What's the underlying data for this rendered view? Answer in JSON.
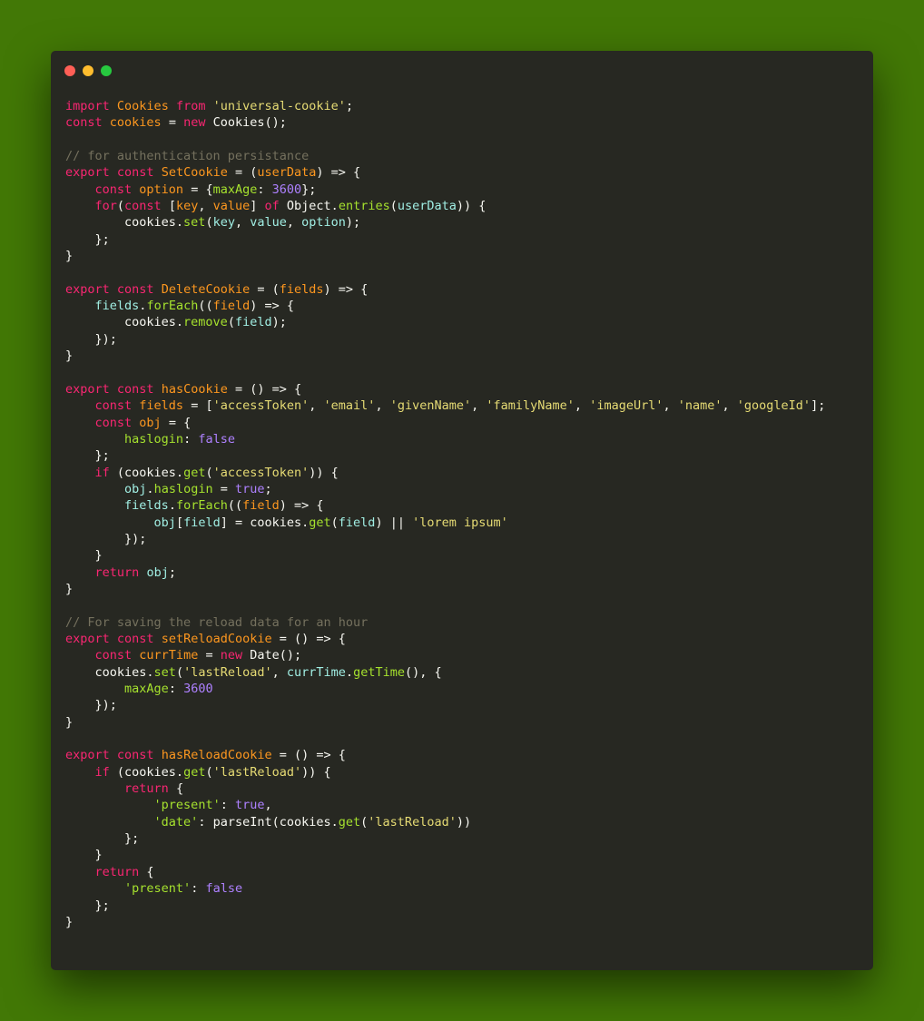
{
  "window": {
    "controls": [
      {
        "name": "close",
        "color": "#ff5f56"
      },
      {
        "name": "minimize",
        "color": "#ffbd2e"
      },
      {
        "name": "maximize",
        "color": "#27c93f"
      }
    ]
  },
  "theme": {
    "background": "#427806",
    "editor_bg": "#272822",
    "keyword": "#f92672",
    "definition": "#fd971f",
    "string": "#e6db74",
    "comment": "#75715e",
    "function": "#a6e22e",
    "variable": "#a1efe4",
    "number": "#ae81ff",
    "text": "#f8f8f2"
  },
  "code": {
    "language": "javascript",
    "lines": [
      [
        [
          "kw",
          "import"
        ],
        [
          "t",
          " "
        ],
        [
          "def",
          "Cookies"
        ],
        [
          "t",
          " "
        ],
        [
          "kw",
          "from"
        ],
        [
          "t",
          " "
        ],
        [
          "str",
          "'universal-cookie'"
        ],
        [
          "t",
          ";"
        ]
      ],
      [
        [
          "kw",
          "const"
        ],
        [
          "t",
          " "
        ],
        [
          "def",
          "cookies"
        ],
        [
          "t",
          " = "
        ],
        [
          "kw",
          "new"
        ],
        [
          "t",
          " Cookies();"
        ]
      ],
      [],
      [
        [
          "com",
          "// for authentication persistance"
        ]
      ],
      [
        [
          "kw",
          "export"
        ],
        [
          "t",
          " "
        ],
        [
          "kw",
          "const"
        ],
        [
          "t",
          " "
        ],
        [
          "def",
          "SetCookie"
        ],
        [
          "t",
          " = ("
        ],
        [
          "def",
          "userData"
        ],
        [
          "t",
          ") => {"
        ]
      ],
      [
        [
          "t",
          "    "
        ],
        [
          "kw",
          "const"
        ],
        [
          "t",
          " "
        ],
        [
          "def",
          "option"
        ],
        [
          "t",
          " = {"
        ],
        [
          "fn",
          "maxAge"
        ],
        [
          "t",
          ": "
        ],
        [
          "num",
          "3600"
        ],
        [
          "t",
          "};"
        ]
      ],
      [
        [
          "t",
          "    "
        ],
        [
          "kw",
          "for"
        ],
        [
          "t",
          "("
        ],
        [
          "kw",
          "const"
        ],
        [
          "t",
          " ["
        ],
        [
          "def",
          "key"
        ],
        [
          "t",
          ", "
        ],
        [
          "def",
          "value"
        ],
        [
          "t",
          "] "
        ],
        [
          "kw",
          "of"
        ],
        [
          "t",
          " Object."
        ],
        [
          "fn",
          "entries"
        ],
        [
          "t",
          "("
        ],
        [
          "var",
          "userData"
        ],
        [
          "t",
          ")) {"
        ]
      ],
      [
        [
          "t",
          "        cookies."
        ],
        [
          "fn",
          "set"
        ],
        [
          "t",
          "("
        ],
        [
          "var",
          "key"
        ],
        [
          "t",
          ", "
        ],
        [
          "var",
          "value"
        ],
        [
          "t",
          ", "
        ],
        [
          "var",
          "option"
        ],
        [
          "t",
          ");"
        ]
      ],
      [
        [
          "t",
          "    };"
        ]
      ],
      [
        [
          "t",
          "}"
        ]
      ],
      [],
      [
        [
          "kw",
          "export"
        ],
        [
          "t",
          " "
        ],
        [
          "kw",
          "const"
        ],
        [
          "t",
          " "
        ],
        [
          "def",
          "DeleteCookie"
        ],
        [
          "t",
          " = ("
        ],
        [
          "def",
          "fields"
        ],
        [
          "t",
          ") => {"
        ]
      ],
      [
        [
          "t",
          "    "
        ],
        [
          "var",
          "fields"
        ],
        [
          "t",
          "."
        ],
        [
          "fn",
          "forEach"
        ],
        [
          "t",
          "(("
        ],
        [
          "def",
          "field"
        ],
        [
          "t",
          ") => {"
        ]
      ],
      [
        [
          "t",
          "        cookies."
        ],
        [
          "fn",
          "remove"
        ],
        [
          "t",
          "("
        ],
        [
          "var",
          "field"
        ],
        [
          "t",
          ");"
        ]
      ],
      [
        [
          "t",
          "    });"
        ]
      ],
      [
        [
          "t",
          "}"
        ]
      ],
      [],
      [
        [
          "kw",
          "export"
        ],
        [
          "t",
          " "
        ],
        [
          "kw",
          "const"
        ],
        [
          "t",
          " "
        ],
        [
          "def",
          "hasCookie"
        ],
        [
          "t",
          " = () => {"
        ]
      ],
      [
        [
          "t",
          "    "
        ],
        [
          "kw",
          "const"
        ],
        [
          "t",
          " "
        ],
        [
          "def",
          "fields"
        ],
        [
          "t",
          " = ["
        ],
        [
          "str",
          "'accessToken'"
        ],
        [
          "t",
          ", "
        ],
        [
          "str",
          "'email'"
        ],
        [
          "t",
          ", "
        ],
        [
          "str",
          "'givenName'"
        ],
        [
          "t",
          ", "
        ],
        [
          "str",
          "'familyName'"
        ],
        [
          "t",
          ", "
        ],
        [
          "str",
          "'imageUrl'"
        ],
        [
          "t",
          ", "
        ],
        [
          "str",
          "'name'"
        ],
        [
          "t",
          ", "
        ],
        [
          "str",
          "'googleId'"
        ],
        [
          "t",
          "];"
        ]
      ],
      [
        [
          "t",
          "    "
        ],
        [
          "kw",
          "const"
        ],
        [
          "t",
          " "
        ],
        [
          "def",
          "obj"
        ],
        [
          "t",
          " = {"
        ]
      ],
      [
        [
          "t",
          "        "
        ],
        [
          "fn",
          "haslogin"
        ],
        [
          "t",
          ": "
        ],
        [
          "num",
          "false"
        ]
      ],
      [
        [
          "t",
          "    };"
        ]
      ],
      [
        [
          "t",
          "    "
        ],
        [
          "kw",
          "if"
        ],
        [
          "t",
          " (cookies."
        ],
        [
          "fn",
          "get"
        ],
        [
          "t",
          "("
        ],
        [
          "str",
          "'accessToken'"
        ],
        [
          "t",
          ")) {"
        ]
      ],
      [
        [
          "t",
          "        "
        ],
        [
          "var",
          "obj"
        ],
        [
          "t",
          "."
        ],
        [
          "fn",
          "haslogin"
        ],
        [
          "t",
          " = "
        ],
        [
          "num",
          "true"
        ],
        [
          "t",
          ";"
        ]
      ],
      [
        [
          "t",
          "        "
        ],
        [
          "var",
          "fields"
        ],
        [
          "t",
          "."
        ],
        [
          "fn",
          "forEach"
        ],
        [
          "t",
          "(("
        ],
        [
          "def",
          "field"
        ],
        [
          "t",
          ") => {"
        ]
      ],
      [
        [
          "t",
          "            "
        ],
        [
          "var",
          "obj"
        ],
        [
          "t",
          "["
        ],
        [
          "var",
          "field"
        ],
        [
          "t",
          "] = cookies."
        ],
        [
          "fn",
          "get"
        ],
        [
          "t",
          "("
        ],
        [
          "var",
          "field"
        ],
        [
          "t",
          ") || "
        ],
        [
          "str",
          "'lorem ipsum'"
        ]
      ],
      [
        [
          "t",
          "        });"
        ]
      ],
      [
        [
          "t",
          "    }"
        ]
      ],
      [
        [
          "t",
          "    "
        ],
        [
          "kw",
          "return"
        ],
        [
          "t",
          " "
        ],
        [
          "var",
          "obj"
        ],
        [
          "t",
          ";"
        ]
      ],
      [
        [
          "t",
          "}"
        ]
      ],
      [],
      [
        [
          "com",
          "// For saving the reload data for an hour"
        ]
      ],
      [
        [
          "kw",
          "export"
        ],
        [
          "t",
          " "
        ],
        [
          "kw",
          "const"
        ],
        [
          "t",
          " "
        ],
        [
          "def",
          "setReloadCookie"
        ],
        [
          "t",
          " = () => {"
        ]
      ],
      [
        [
          "t",
          "    "
        ],
        [
          "kw",
          "const"
        ],
        [
          "t",
          " "
        ],
        [
          "def",
          "currTime"
        ],
        [
          "t",
          " = "
        ],
        [
          "kw",
          "new"
        ],
        [
          "t",
          " Date();"
        ]
      ],
      [
        [
          "t",
          "    cookies."
        ],
        [
          "fn",
          "set"
        ],
        [
          "t",
          "("
        ],
        [
          "str",
          "'lastReload'"
        ],
        [
          "t",
          ", "
        ],
        [
          "var",
          "currTime"
        ],
        [
          "t",
          "."
        ],
        [
          "fn",
          "getTime"
        ],
        [
          "t",
          "(), {"
        ]
      ],
      [
        [
          "t",
          "        "
        ],
        [
          "fn",
          "maxAge"
        ],
        [
          "t",
          ": "
        ],
        [
          "num",
          "3600"
        ]
      ],
      [
        [
          "t",
          "    });"
        ]
      ],
      [
        [
          "t",
          "}"
        ]
      ],
      [],
      [
        [
          "kw",
          "export"
        ],
        [
          "t",
          " "
        ],
        [
          "kw",
          "const"
        ],
        [
          "t",
          " "
        ],
        [
          "def",
          "hasReloadCookie"
        ],
        [
          "t",
          " = () => {"
        ]
      ],
      [
        [
          "t",
          "    "
        ],
        [
          "kw",
          "if"
        ],
        [
          "t",
          " (cookies."
        ],
        [
          "fn",
          "get"
        ],
        [
          "t",
          "("
        ],
        [
          "str",
          "'lastReload'"
        ],
        [
          "t",
          ")) {"
        ]
      ],
      [
        [
          "t",
          "        "
        ],
        [
          "kw",
          "return"
        ],
        [
          "t",
          " {"
        ]
      ],
      [
        [
          "t",
          "            "
        ],
        [
          "fn",
          "'present'"
        ],
        [
          "t",
          ": "
        ],
        [
          "num",
          "true"
        ],
        [
          "t",
          ","
        ]
      ],
      [
        [
          "t",
          "            "
        ],
        [
          "fn",
          "'date'"
        ],
        [
          "t",
          ": parseInt(cookies."
        ],
        [
          "fn",
          "get"
        ],
        [
          "t",
          "("
        ],
        [
          "str",
          "'lastReload'"
        ],
        [
          "t",
          "))"
        ]
      ],
      [
        [
          "t",
          "        };"
        ]
      ],
      [
        [
          "t",
          "    }"
        ]
      ],
      [
        [
          "t",
          "    "
        ],
        [
          "kw",
          "return"
        ],
        [
          "t",
          " {"
        ]
      ],
      [
        [
          "t",
          "        "
        ],
        [
          "fn",
          "'present'"
        ],
        [
          "t",
          ": "
        ],
        [
          "num",
          "false"
        ]
      ],
      [
        [
          "t",
          "    };"
        ]
      ],
      [
        [
          "t",
          "}"
        ]
      ]
    ]
  }
}
